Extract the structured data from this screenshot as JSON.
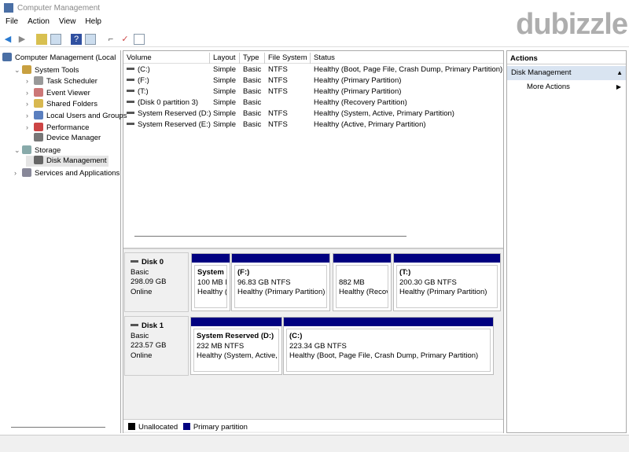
{
  "window": {
    "title": "Computer Management"
  },
  "watermark": "dubizzle",
  "menu": [
    "File",
    "Action",
    "View",
    "Help"
  ],
  "tree": [
    {
      "label": "Computer Management (Local",
      "indent": 0,
      "chev": "",
      "color": "#4a6fa5"
    },
    {
      "label": "System Tools",
      "indent": 1,
      "chev": "⌄",
      "color": "#c8a040"
    },
    {
      "label": "Task Scheduler",
      "indent": 2,
      "chev": "›",
      "color": "#999"
    },
    {
      "label": "Event Viewer",
      "indent": 2,
      "chev": "›",
      "color": "#c77"
    },
    {
      "label": "Shared Folders",
      "indent": 2,
      "chev": "›",
      "color": "#d8b850"
    },
    {
      "label": "Local Users and Groups",
      "indent": 2,
      "chev": "›",
      "color": "#5a7fbf"
    },
    {
      "label": "Performance",
      "indent": 2,
      "chev": "›",
      "color": "#c44"
    },
    {
      "label": "Device Manager",
      "indent": 2,
      "chev": "",
      "color": "#777"
    },
    {
      "label": "Storage",
      "indent": 1,
      "chev": "⌄",
      "color": "#8aa"
    },
    {
      "label": "Disk Management",
      "indent": 2,
      "chev": "",
      "color": "#666",
      "selected": true
    },
    {
      "label": "Services and Applications",
      "indent": 1,
      "chev": "›",
      "color": "#889"
    }
  ],
  "table": {
    "columns": [
      "Volume",
      "Layout",
      "Type",
      "File System",
      "Status"
    ],
    "rows": [
      [
        "(C:)",
        "Simple",
        "Basic",
        "NTFS",
        "Healthy (Boot, Page File, Crash Dump, Primary Partition)"
      ],
      [
        "(F:)",
        "Simple",
        "Basic",
        "NTFS",
        "Healthy (Primary Partition)"
      ],
      [
        "(T:)",
        "Simple",
        "Basic",
        "NTFS",
        "Healthy (Primary Partition)"
      ],
      [
        "(Disk 0 partition 3)",
        "Simple",
        "Basic",
        "",
        "Healthy (Recovery Partition)"
      ],
      [
        "System Reserved (D:)",
        "Simple",
        "Basic",
        "NTFS",
        "Healthy (System, Active, Primary Partition)"
      ],
      [
        "System Reserved (E:)",
        "Simple",
        "Basic",
        "NTFS",
        "Healthy (Active, Primary Partition)"
      ]
    ]
  },
  "disks": [
    {
      "name": "Disk 0",
      "type": "Basic",
      "size": "298.09 GB",
      "state": "Online",
      "partitions": [
        {
          "name": "System F",
          "size": "100 MB N",
          "status": "Healthy ("
        },
        {
          "name": "(F:)",
          "size": "96.83 GB NTFS",
          "status": "Healthy (Primary Partition)"
        },
        {
          "name": "",
          "size": "882 MB",
          "status": "Healthy (Recov"
        },
        {
          "name": "(T:)",
          "size": "200.30 GB NTFS",
          "status": "Healthy (Primary Partition)"
        }
      ]
    },
    {
      "name": "Disk 1",
      "type": "Basic",
      "size": "223.57 GB",
      "state": "Online",
      "partitions": [
        {
          "name": "System Reserved  (D:)",
          "size": "232 MB NTFS",
          "status": "Healthy (System, Active,"
        },
        {
          "name": "(C:)",
          "size": "223.34 GB NTFS",
          "status": "Healthy (Boot, Page File, Crash Dump, Primary Partition)"
        }
      ]
    }
  ],
  "legend": [
    {
      "label": "Unallocated",
      "color": "#000000"
    },
    {
      "label": "Primary partition",
      "color": "#000080"
    }
  ],
  "actions": {
    "header": "Actions",
    "section": "Disk Management",
    "more": "More Actions"
  }
}
